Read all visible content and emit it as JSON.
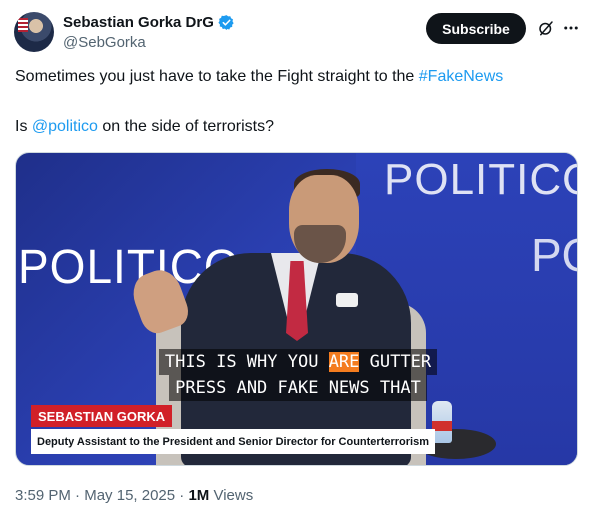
{
  "author": {
    "display_name": "Sebastian Gorka DrG",
    "handle": "@SebGorka",
    "verified_icon": "verified-badge-icon",
    "verified_color": "#1d9bf0"
  },
  "actions": {
    "subscribe_label": "Subscribe",
    "grok_icon": "grok-icon",
    "more_icon": "more-icon"
  },
  "tweet": {
    "line1_text": "Sometimes you just have to take the Fight straight to the ",
    "line1_hashtag": "#FakeNews",
    "line2_prefix": "Is ",
    "line2_mention": "@politico",
    "line2_suffix": " on the side of terrorists?"
  },
  "media": {
    "caption_line1_a": "THIS IS WHY YOU ",
    "caption_line1_highlight": "ARE",
    "caption_line1_b": " GUTTER",
    "caption_line2": "PRESS AND FAKE NEWS THAT",
    "lower_third_name": "SEBASTIAN GORKA",
    "lower_third_title": "Deputy Assistant to the President and Senior Director for Counterterrorism",
    "bg_logo_left": "POLITICO",
    "bg_logo_top": "POLITICO",
    "bg_logo_right": "PO",
    "accent_red": "#d12028",
    "highlight_orange": "#f47c1f"
  },
  "meta": {
    "time": "3:59 PM",
    "separator": " · ",
    "date": "May 15, 2025",
    "views_count": "1M",
    "views_label": " Views"
  }
}
